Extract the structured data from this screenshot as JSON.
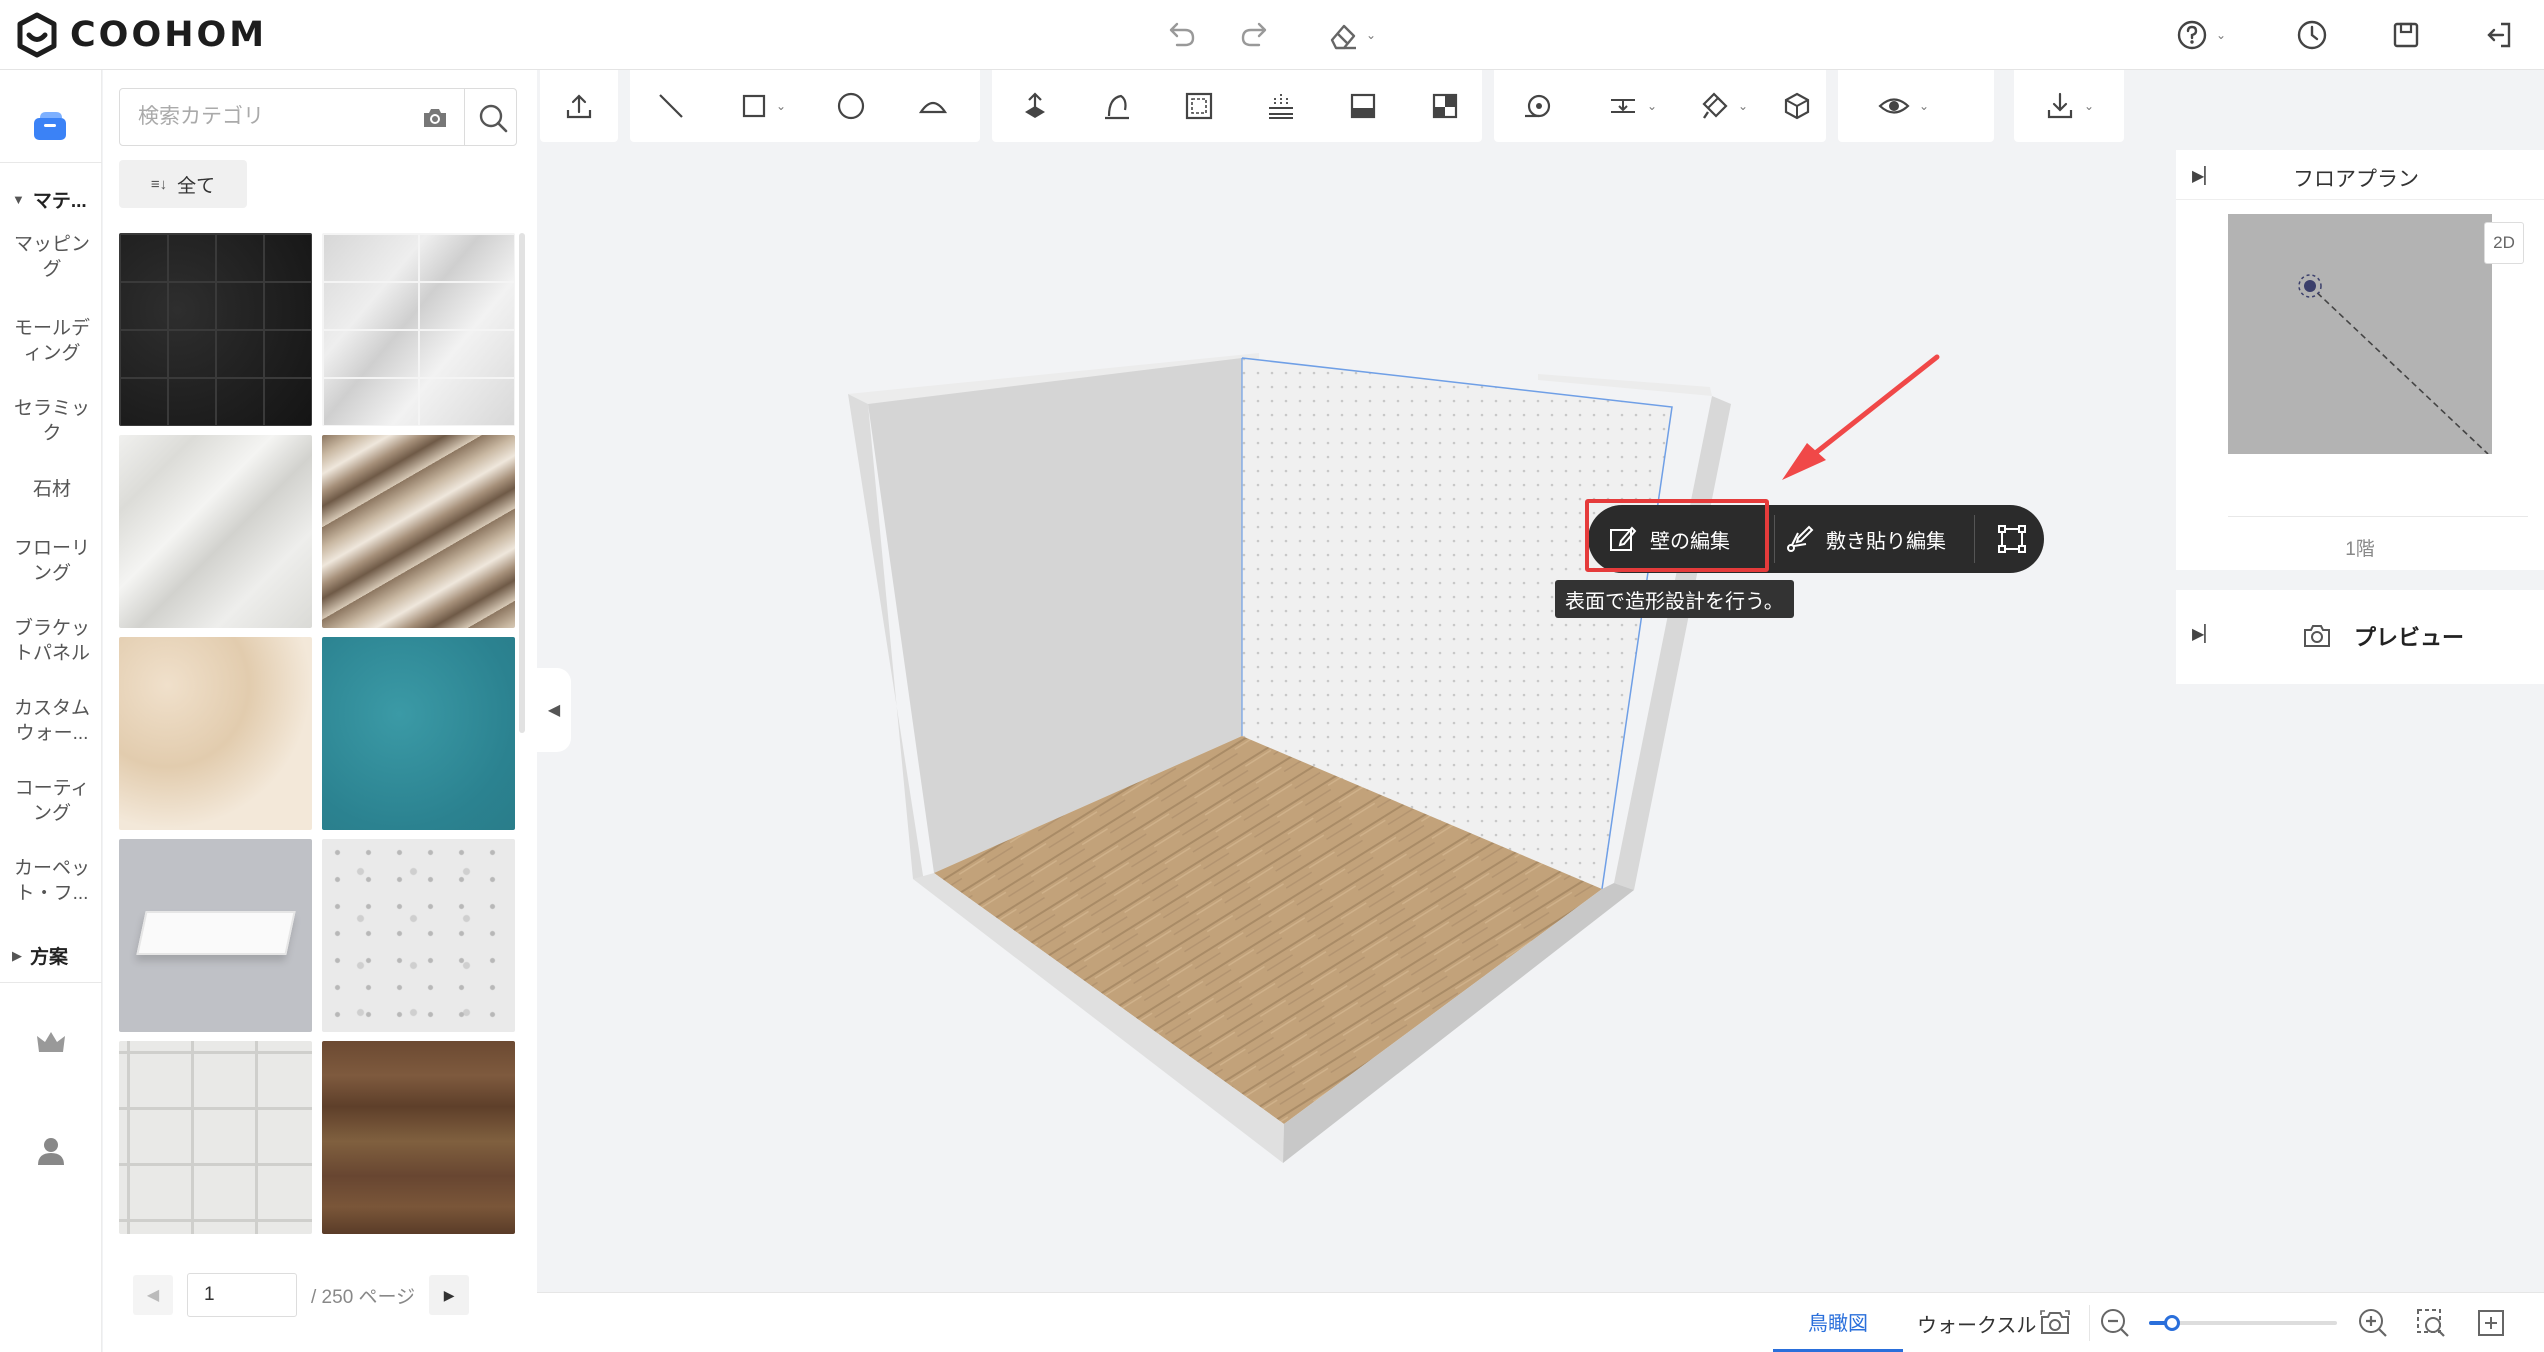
{
  "app": {
    "name": "COOHOM"
  },
  "header": {
    "icons": [
      "undo-icon",
      "redo-icon",
      "eraser-icon",
      "help-icon",
      "history-icon",
      "save-icon",
      "exit-icon"
    ]
  },
  "rail": {
    "sections": [
      {
        "label": "マテ...",
        "items": [
          "マッピング",
          "モールディング",
          "セラミック",
          "石材",
          "フローリング",
          "ブラケットパネル",
          "カスタムウォー...",
          "コーティング",
          "カーペット・フ..."
        ]
      },
      {
        "label": "方案"
      }
    ]
  },
  "panel": {
    "search_placeholder": "検索カテゴリ",
    "filter_label": "全て",
    "materials": [
      "black-marble-tile",
      "white-marble-tile",
      "white-marble",
      "brown-marble",
      "beige-marble",
      "teal-carpet",
      "ceiling-light-panel",
      "white-terrazzo",
      "white-stone-relief",
      "dark-wood"
    ],
    "pagination": {
      "current": "1",
      "total": "/ 250 ページ"
    }
  },
  "toolbar": {
    "icons": [
      "upload-icon",
      "line-icon",
      "rectangle-icon",
      "circle-icon",
      "arc-icon",
      "opening-icon",
      "door-icon",
      "room-frame-icon",
      "floor-heating-icon",
      "panel-icon",
      "layout-icon",
      "measure-icon",
      "dimension-icon",
      "paint-icon",
      "cube-icon",
      "view-icon",
      "download-icon"
    ]
  },
  "context_menu": {
    "items": [
      {
        "label": "壁の編集",
        "icon": "wall-edit-icon"
      },
      {
        "label": "敷き貼り編集",
        "icon": "tile-edit-icon"
      },
      {
        "icon": "transform-icon"
      }
    ],
    "tooltip": "表面で造形設計を行う。"
  },
  "floorplan": {
    "title": "フロアプラン",
    "mode_button": "2D",
    "floor_label": "1階"
  },
  "preview": {
    "title": "プレビュー"
  },
  "bottom": {
    "tabs": [
      {
        "label": "鳥瞰図",
        "active": true
      },
      {
        "label": "ウォークスルー",
        "active": false
      }
    ],
    "zoom_level": 0.12
  },
  "colors": {
    "accent": "#2a6fdb",
    "highlight": "#e53b3b",
    "menu_bg": "#2b2b2b"
  }
}
